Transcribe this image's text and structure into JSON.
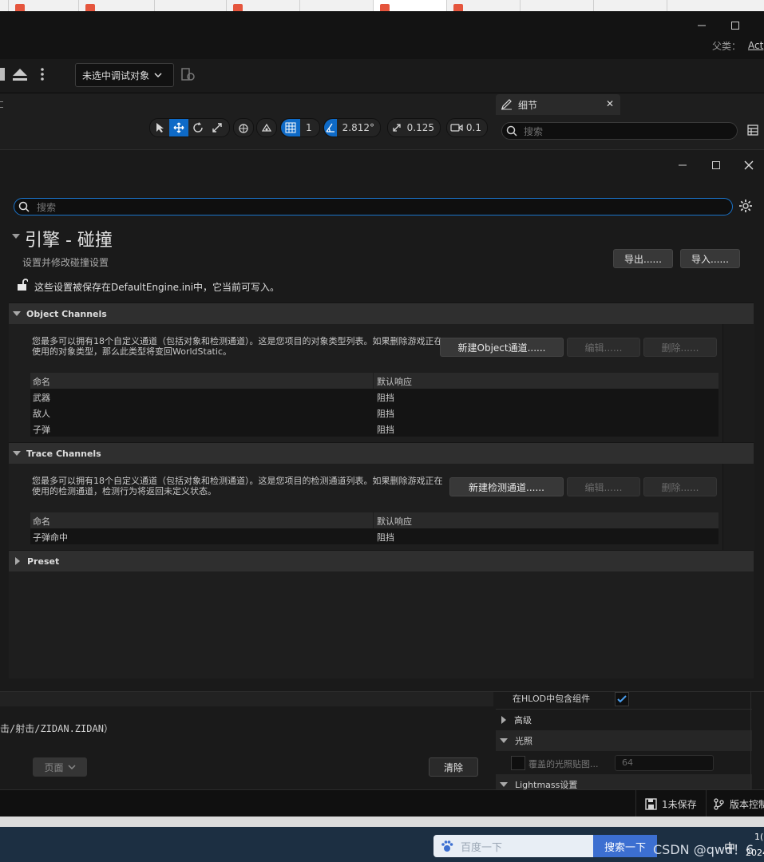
{
  "titlebar": {
    "parent_label": "父类：",
    "parent_value": "Act"
  },
  "toolbar": {
    "debug_dropdown": "未选中调试对象"
  },
  "viewport": {
    "grid_snap": "1",
    "rotation_snap": "2.812°",
    "scale_snap": "0.125",
    "camera_speed": "0.1"
  },
  "details": {
    "tab_title": "细节",
    "search_placeholder": "搜索"
  },
  "modal": {
    "search_placeholder": "搜索",
    "section_title": "引擎 - 碰撞",
    "section_subtitle": "设置并修改碰撞设置",
    "export_label": "导出......",
    "import_label": "导入......",
    "notice": "这些设置被保存在DefaultEngine.ini中，它当前可写入。",
    "object_channels": {
      "title": "Object Channels",
      "description": "您最多可以拥有18个自定义通道（包括对象和检测通道）。这是您项目的对象类型列表。如果删除游戏正在使用的对象类型，那么此类型将变回WorldStatic。",
      "new_button": "新建Object通道......",
      "edit_button": "编辑......",
      "delete_button": "删除......",
      "columns": [
        "命名",
        "默认响应"
      ],
      "rows": [
        {
          "name": "武器",
          "response": "阻挡"
        },
        {
          "name": "敌人",
          "response": "阻挡"
        },
        {
          "name": "子弹",
          "response": "阻挡"
        }
      ]
    },
    "trace_channels": {
      "title": "Trace Channels",
      "description": "您最多可以拥有18个自定义通道（包括对象和检测通道）。这是您项目的检测通道列表。如果删除游戏正在使用的检测通道，检测行为将返回未定义状态。",
      "new_button": "新建检测通道......",
      "edit_button": "编辑......",
      "delete_button": "删除......",
      "columns": [
        "命名",
        "默认响应"
      ],
      "rows": [
        {
          "name": "子弹命中",
          "response": "阻挡"
        }
      ]
    },
    "preset": {
      "title": "Preset"
    }
  },
  "log": {
    "path_text": "击/射击/ZIDAN.ZIDAN）",
    "page_dropdown": "页面",
    "clear_button": "清除"
  },
  "properties": {
    "hlod_label": "在HLOD中包含组件",
    "advanced": "高级",
    "lighting": "光照",
    "lightmap_override": "覆盖的光照贴图...",
    "lightmap_value": "64",
    "lightmass": "Lightmass设置"
  },
  "statusbar": {
    "unsaved": "1未保存",
    "version_control": "版本控制"
  },
  "taskbar": {
    "search_placeholder": "百度一下",
    "search_button": "搜索一下",
    "watermark": "CSDN @qwd！6",
    "ime": "中",
    "clock_top": "1(",
    "clock_bottom": "2024"
  }
}
